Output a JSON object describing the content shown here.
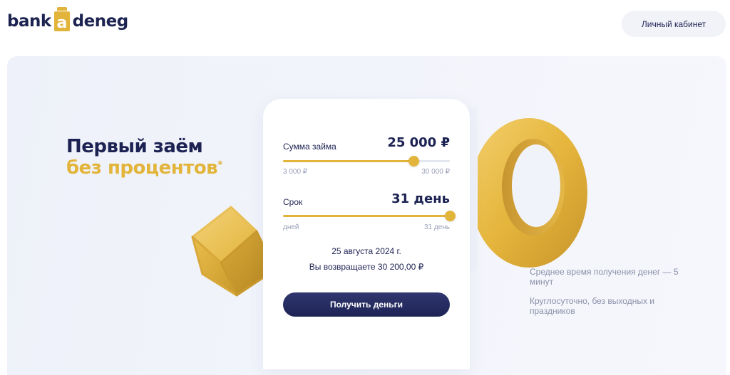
{
  "header": {
    "logo_left": "bank",
    "logo_mark": "a",
    "logo_right": "deneg",
    "cabinet_button": "Личный кабинет"
  },
  "hero": {
    "title_line1": "Первый заём",
    "title_line2": "без процентов",
    "title_star": "*"
  },
  "calculator": {
    "amount": {
      "label": "Сумма займа",
      "value": "25 000 ₽",
      "min_label": "3 000 ₽",
      "max_label": "30 000 ₽",
      "fraction": 0.78
    },
    "term": {
      "label": "Срок",
      "value": "31 день",
      "min_label": "дней",
      "max_label": "31 день",
      "fraction": 1.0
    },
    "due_date": "25 августа 2024 г.",
    "return_text": "Вы возвращаете 30 200,00 ₽",
    "submit_button": "Получить деньги"
  },
  "info": {
    "line1": "Среднее время получения денег — 5 минут",
    "line2": "Круглосуточно, без выходных и праздников"
  },
  "colors": {
    "brand_navy": "#1c2252",
    "accent_gold": "#e2b43a",
    "hero_bg": "#f0f2fa"
  },
  "icons": {
    "cube": "gold-cube-decoration",
    "ring": "gold-ring-decoration"
  }
}
